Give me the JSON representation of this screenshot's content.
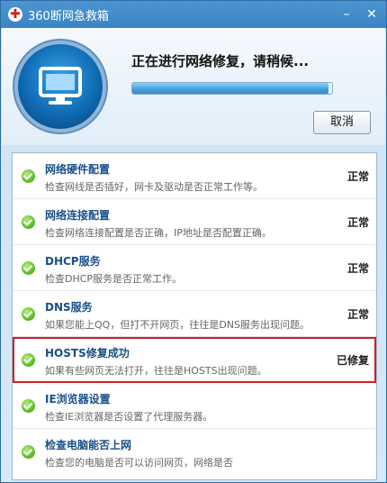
{
  "window": {
    "title": "360断网急救箱"
  },
  "header": {
    "status_title": "正在进行网络修复，请稍候...",
    "progress": 0.98,
    "cancel_label": "取消"
  },
  "items": [
    {
      "title": "网络硬件配置",
      "desc": "检查网线是否插好，网卡及驱动是否正常工作等。",
      "status": "正常"
    },
    {
      "title": "网络连接配置",
      "desc": "检查网络连接配置是否正确，IP地址是否配置正确。",
      "status": "正常"
    },
    {
      "title": "DHCP服务",
      "desc": "检查DHCP服务是否正常工作。",
      "status": "正常"
    },
    {
      "title": "DNS服务",
      "desc": "如果您能上QQ，但打不开网页，往往是DNS服务出现问题。",
      "status": "正常"
    },
    {
      "title": "HOSTS修复成功",
      "desc": "如果有些网页无法打开，往往是HOSTS出现问题。",
      "status": "已修复"
    },
    {
      "title": "IE浏览器设置",
      "desc": "检查IE浏览器是否设置了代理服务器。",
      "status": ""
    },
    {
      "title": "检查电脑能否上网",
      "desc": "检查您的电脑是否可以访问网页，网络是否",
      "status": ""
    }
  ],
  "colors": {
    "highlight": "#d21f1f",
    "accent": "#3a85c6"
  },
  "icons": {
    "app": "first-aid-cross-icon",
    "monitor": "monitor-icon",
    "check": "green-check-icon"
  }
}
